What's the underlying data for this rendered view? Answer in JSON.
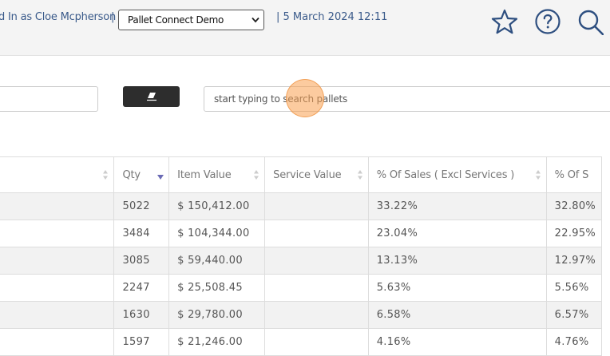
{
  "header": {
    "logged_in_text": "d In as Cloe Mcpherson",
    "separator": "|",
    "site_select_value": "Pallet Connect Demo",
    "datetime_text": "| 5 March 2024 12:11",
    "icons": [
      "star-icon",
      "help-icon",
      "search-icon"
    ]
  },
  "search": {
    "placeholder": "start typing to search pallets",
    "clear_icon": "eraser-icon"
  },
  "table": {
    "columns": [
      {
        "label": ""
      },
      {
        "label": "Qty"
      },
      {
        "label": "Item Value"
      },
      {
        "label": "Service Value"
      },
      {
        "label": "% Of Sales ( Excl Services )"
      },
      {
        "label": "% Of S"
      }
    ],
    "rows": [
      {
        "name": "",
        "qty": "5022",
        "item_value": "$ 150,412.00",
        "service_value": "",
        "pct_excl": "33.22%",
        "pct_other": "32.80%"
      },
      {
        "name": "",
        "qty": "3484",
        "item_value": "$ 104,344.00",
        "service_value": "",
        "pct_excl": "23.04%",
        "pct_other": "22.95%"
      },
      {
        "name": "",
        "qty": "3085",
        "item_value": "$ 59,440.00",
        "service_value": "",
        "pct_excl": "13.13%",
        "pct_other": "12.97%"
      },
      {
        "name": "",
        "qty": "2247",
        "item_value": "$ 25,508.45",
        "service_value": "",
        "pct_excl": "5.63%",
        "pct_other": "5.56%"
      },
      {
        "name": "",
        "qty": "1630",
        "item_value": "$ 29,780.00",
        "service_value": "",
        "pct_excl": "6.58%",
        "pct_other": "6.57%"
      },
      {
        "name": "",
        "qty": "1597",
        "item_value": "$ 21,246.00",
        "service_value": "",
        "pct_excl": "4.16%",
        "pct_other": "4.76%"
      }
    ]
  },
  "colors": {
    "link_blue": "#3a5a8a",
    "dark_button": "#2d2d2d",
    "sort_active": "#6b6bb5"
  }
}
